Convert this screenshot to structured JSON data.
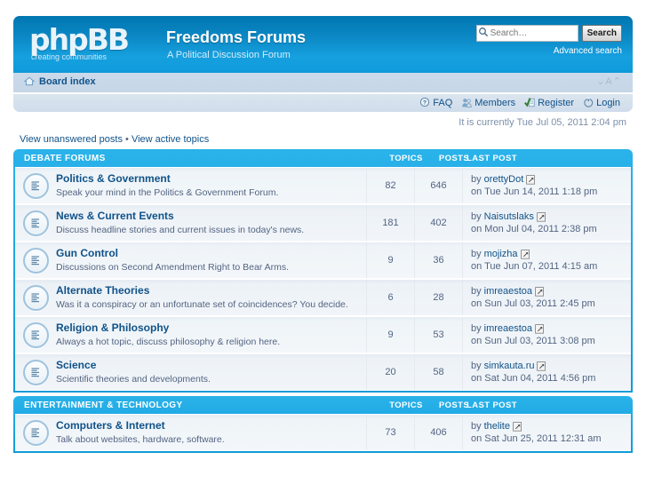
{
  "header": {
    "logo_text": "phpBB",
    "logo_tagline": "creating communities",
    "site_title": "Freedoms Forums",
    "site_description": "A Political Discussion Forum",
    "search": {
      "placeholder": "Search…",
      "value": "",
      "button_label": "Search",
      "advanced_label": "Advanced search",
      "icon": "search-icon"
    }
  },
  "navbar": {
    "breadcrumb": "Board index",
    "home_icon": "home-icon",
    "fontsize_control": "⌄A⌃",
    "quicklinks": [
      {
        "label": "FAQ",
        "icon": "question-icon"
      },
      {
        "label": "Members",
        "icon": "members-icon"
      },
      {
        "label": "Register",
        "icon": "register-icon"
      },
      {
        "label": "Login",
        "icon": "power-icon"
      }
    ],
    "current_time": "It is currently Tue Jul 05, 2011 2:04 pm"
  },
  "actionbar": {
    "unanswered_label": "View unanswered posts",
    "separator": "•",
    "active_label": "View active topics"
  },
  "columns": {
    "topics": "TOPICS",
    "posts": "POSTS",
    "lastpost": "LAST POST"
  },
  "colors": {
    "header_blue": "#0f9ada",
    "category_blue": "#16a5e6",
    "link_blue": "#105289",
    "text_blue": "#536482",
    "row_bg": "#eef3f7"
  },
  "categories": [
    {
      "name": "DEBATE FORUMS",
      "forums": [
        {
          "title": "Politics & Government",
          "desc": "Speak your mind in the Politics & Government Forum.",
          "topics": "82",
          "posts": "646",
          "lastpost_by_prefix": "by",
          "lastpost_author": "orettyDot",
          "lastpost_date": "on Tue Jun 14, 2011 1:18 pm",
          "icon": "forum-lines-icon",
          "lastpost_icon": "goto-last-post-icon"
        },
        {
          "title": "News & Current Events",
          "desc": "Discuss headline stories and current issues in today's news.",
          "topics": "181",
          "posts": "402",
          "lastpost_by_prefix": "by",
          "lastpost_author": "Naisutslaks",
          "lastpost_date": "on Mon Jul 04, 2011 2:38 pm",
          "icon": "forum-lines-icon",
          "lastpost_icon": "goto-last-post-icon"
        },
        {
          "title": "Gun Control",
          "desc": "Discussions on Second Amendment Right to Bear Arms.",
          "topics": "9",
          "posts": "36",
          "lastpost_by_prefix": "by",
          "lastpost_author": "mojizha",
          "lastpost_date": "on Tue Jun 07, 2011 4:15 am",
          "icon": "forum-lines-icon",
          "lastpost_icon": "goto-last-post-icon"
        },
        {
          "title": "Alternate Theories",
          "desc": "Was it a conspiracy or an unfortunate set of coincidences? You decide.",
          "topics": "6",
          "posts": "28",
          "lastpost_by_prefix": "by",
          "lastpost_author": "imreaestoa",
          "lastpost_date": "on Sun Jul 03, 2011 2:45 pm",
          "icon": "forum-lines-icon",
          "lastpost_icon": "goto-last-post-icon"
        },
        {
          "title": "Religion & Philosophy",
          "desc": "Always a hot topic, discuss philosophy & religion here.",
          "topics": "9",
          "posts": "53",
          "lastpost_by_prefix": "by",
          "lastpost_author": "imreaestoa",
          "lastpost_date": "on Sun Jul 03, 2011 3:08 pm",
          "icon": "forum-lines-icon",
          "lastpost_icon": "goto-last-post-icon"
        },
        {
          "title": "Science",
          "desc": "Scientific theories and developments.",
          "topics": "20",
          "posts": "58",
          "lastpost_by_prefix": "by",
          "lastpost_author": "simkauta.ru",
          "lastpost_date": "on Sat Jun 04, 2011 4:56 pm",
          "icon": "forum-lines-icon",
          "lastpost_icon": "goto-last-post-icon"
        }
      ]
    },
    {
      "name": "ENTERTAINMENT & TECHNOLOGY",
      "forums": [
        {
          "title": "Computers & Internet",
          "desc": "Talk about websites, hardware, software.",
          "topics": "73",
          "posts": "406",
          "lastpost_by_prefix": "by",
          "lastpost_author": "thelite",
          "lastpost_date": "on Sat Jun 25, 2011 12:31 am",
          "icon": "forum-lines-icon",
          "lastpost_icon": "goto-last-post-icon"
        }
      ]
    }
  ]
}
